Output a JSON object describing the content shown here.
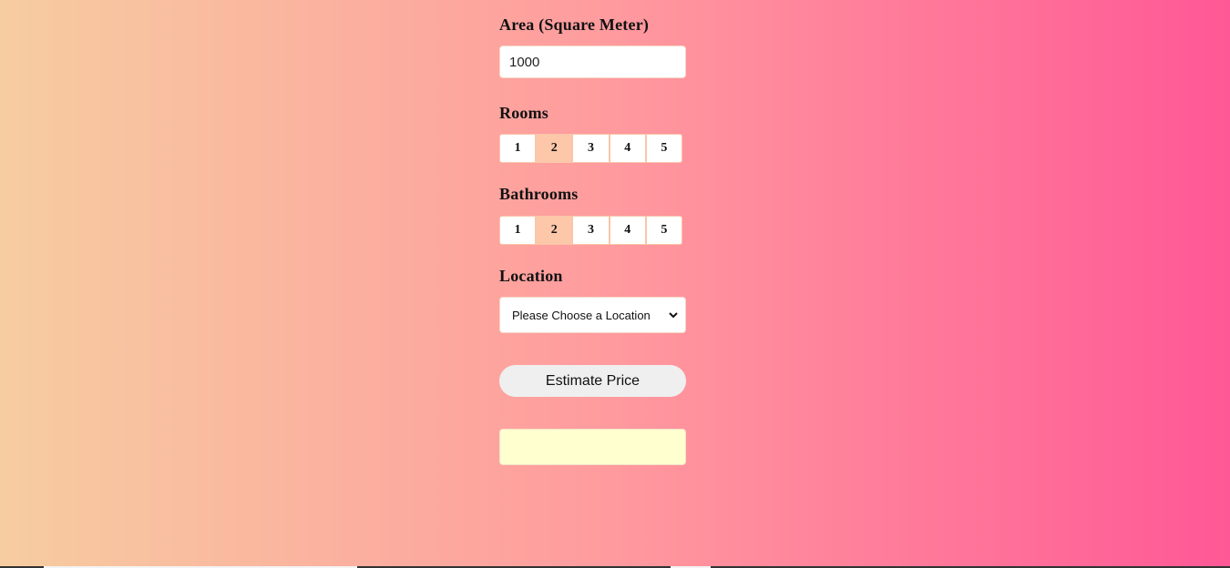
{
  "area": {
    "label": "Area (Square Meter)",
    "value": "1000",
    "placeholder": ""
  },
  "rooms": {
    "label": "Rooms",
    "options": [
      "1",
      "2",
      "3",
      "4",
      "5"
    ],
    "selected": "2"
  },
  "bathrooms": {
    "label": "Bathrooms",
    "options": [
      "1",
      "2",
      "3",
      "4",
      "5"
    ],
    "selected": "2"
  },
  "location": {
    "label": "Location",
    "selected_text": "Please Choose a Location"
  },
  "estimate_button": {
    "label": "Estimate Price"
  },
  "result": {
    "text": ""
  },
  "colors": {
    "gradient_start": "#f6cda0",
    "gradient_mid": "#ff9a9e",
    "gradient_end": "#ff5896",
    "selected_option": "#fdc8a9",
    "result_background": "#ffffd0",
    "button_background": "#efefef"
  },
  "icons": {
    "location_select": "chevron-down-icon"
  }
}
